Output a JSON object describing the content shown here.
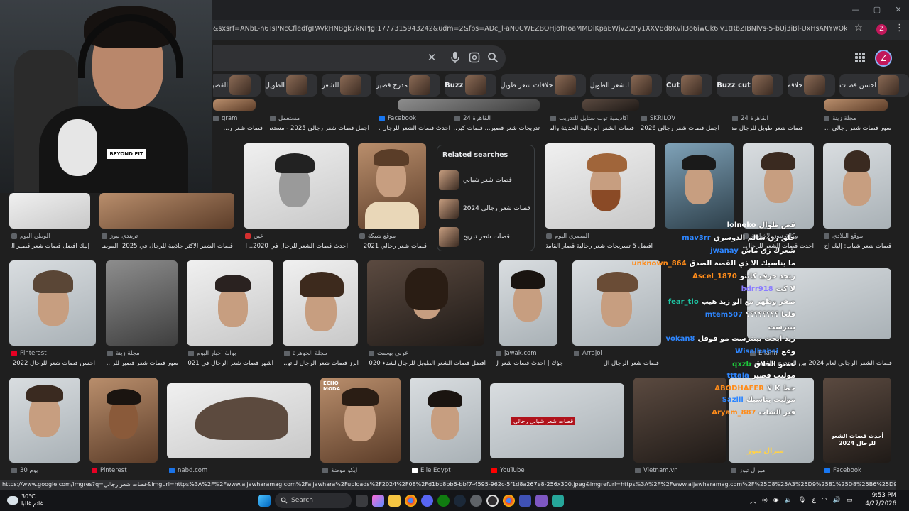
{
  "browser": {
    "url": "&sxsrf=ANbL-n6TsPNcCfledfgPAVkHNBgk7kNPJg:1777315943242&udm=2&fbs=ADc_l-aN0CWEZBOHjofHoaMMDiKpaEWjvZ2Py1XXV8d8KvlI3o6iwGk6lv1tRbZIBNlVs-5-bUj3iBl-UxHsANYwOkWWQqZAJdwuRaSoLHf...",
    "profile_initial": "Z",
    "window_controls": [
      "—",
      "▢",
      "✕"
    ]
  },
  "search": {
    "clear_glyph": "✕",
    "profile_initial": "Z"
  },
  "chips": [
    {
      "label": "احسن قصات"
    },
    {
      "label": "حلاقة"
    },
    {
      "label": "Buzz cut",
      "bold": true
    },
    {
      "label": "Cut",
      "bold": true
    },
    {
      "label": "للشعر الطويل"
    },
    {
      "label": "حلاقات شعر طويل"
    },
    {
      "label": "Buzz",
      "bold": true
    },
    {
      "label": "مدرج قصير"
    },
    {
      "label": "للشعر"
    },
    {
      "label": "الطويل"
    },
    {
      "label": "القصير"
    }
  ],
  "top_row_partial": [
    {
      "source": "gram",
      "caption": "قصات شعر ر..."
    },
    {
      "source": "مستعمل",
      "caption": "أجمل قصات شعر رجالي 2025 - مستعمل"
    },
    {
      "source": "Facebook",
      "caption": "احدث قصات الشعر للرجال ..."
    },
    {
      "source": "القاهرة 24",
      "caption": "تدريجات شعر قصير... قصات كيز..."
    },
    {
      "source": "أكاديمية توب ستايل للتدريب",
      "caption": "قصات الشعر الرجالية الحديثة والم..."
    },
    {
      "source": "SKRILOV",
      "caption": "أجمل قصات شعر رجالي 2026"
    },
    {
      "source": "القاهرة 24",
      "caption": "قصات شعر طويل للرجال مدرج"
    },
    {
      "source": "مجلة زينة",
      "caption": "سور قصات شعر رجالي ..."
    }
  ],
  "row2": [
    {
      "source": "الوطن اليوم",
      "caption": "إليك أفضل قصات شعر قصير ال..."
    },
    {
      "source": "تريندي نيوز",
      "caption": "قصات الشعر الأكثر جاذبية للرجال في 2025: الموضة ت..."
    },
    {
      "source": "عين",
      "caption": "أحدث قصات الشعر للرجال في 2020.. الب..."
    },
    {
      "source": "موقع شبكة",
      "caption": "قصات شعر رجالي 2021"
    },
    {
      "source": "المصري اليوم",
      "caption": "أفضل 5 تسريحات شعر رجالية قصار القامة لو..."
    },
    {
      "source": "أصل 10",
      "caption": "أفضل 10 تسريحات شعر..."
    },
    {
      "source": "وكالة نيوز الإخبارية",
      "caption": "أحدث قصات الشعر للرجال..."
    },
    {
      "source": "موقع البلادي",
      "caption": "قصات شعر شباب: إليك أح..."
    }
  ],
  "related": {
    "title": "Related searches",
    "items": [
      "قصات شعر شبابي",
      "قصات شعر رجالي 2024",
      "قصات شعر تدريج"
    ]
  },
  "row3": [
    {
      "source": "Pinterest",
      "caption": "احسن قصات شعر للرجال 2022"
    },
    {
      "source": "مجلة زينة",
      "caption": "سور قصات شعر قصير للر..."
    },
    {
      "source": "بوابة أخبار اليوم",
      "caption": "أشهر قصات شعر الرجال في 021..."
    },
    {
      "source": "مجلة الجوهرة",
      "caption": "أبرز قصات شعر الرجال لـ تو..."
    },
    {
      "source": "عربي بوست",
      "caption": "أفضل قصات الشعر الطويل للرجال لشتاء 2020"
    },
    {
      "source": "jawak.com",
      "caption": "جؤك | أحدث قصات شعر ل..."
    },
    {
      "source": "Arrajol",
      "caption": "قصات شعر الرجال ال"
    },
    {
      "source": "Elfann",
      "caption": "قصات الشعر الرجالي لعام 2024 بين المتدرج والقصير، جداً وال..."
    }
  ],
  "row4": [
    {
      "source": "30 يوم"
    },
    {
      "source": "Pinterest"
    },
    {
      "source": "nabd.com"
    },
    {
      "source": "ايكو موضة"
    },
    {
      "source": "Elle Egypt"
    },
    {
      "source": "YouTube"
    },
    {
      "source": "Vietnam.vn"
    },
    {
      "source": "ميرال تيوز"
    },
    {
      "source": "Facebook"
    }
  ],
  "thumb_texts": {
    "echo_moda": "ECHO MODA",
    "youtube_overlay": "قصات شعر شبابي رجالي",
    "miral_news": "ميرال نيوز",
    "ahdath": "أحدث قصات الشعر للرجال 2024"
  },
  "chat": [
    {
      "user": "lolneko",
      "msg": "قص طوال",
      "color": "#ffffff"
    },
    {
      "user": "mav3rr",
      "msg": "حلق زي سالم الدوسري",
      "color": "#2e86ff"
    },
    {
      "user": "jwanay",
      "msg": "شعرك زق ماش",
      "color": "#2e86ff"
    },
    {
      "user": "unknown_864",
      "msg": "ما يناسبك الا ذي القصة الصدق",
      "color": "#ff8c1a"
    },
    {
      "user": "Ascel_1870",
      "msg": "رنجد حرف كابتو",
      "color": "#ff8c1a"
    },
    {
      "user": "bdrr918",
      "msg": "لا كت",
      "color": "#8a7cff"
    },
    {
      "user": "fear_tio",
      "msg": "صفر وظهر مع الو زيد هيب",
      "color": "#1ec7a5"
    },
    {
      "user": "mtem507",
      "msg": "قلعا ؟؟؟؟؟؟؟؟",
      "color": "#2e86ff"
    },
    {
      "user": "",
      "msg": "بنترست",
      "color": "#ffffff"
    },
    {
      "user": "vokan8",
      "msg": "زيد ابحث بينترست مو قوقل",
      "color": "#2e86ff"
    },
    {
      "user": "Wisalhabsi",
      "msg": "وعع",
      "color": "#2e86ff"
    },
    {
      "user": "qxzb",
      "msg": "عمتو الحلاق",
      "color": "#1ec73c"
    },
    {
      "user": "tttala",
      "msg": "موليت قصير",
      "color": "#2e86ff"
    },
    {
      "user": "ABODHAFER",
      "msg": "حط K لا",
      "color": "#ff8c1a"
    },
    {
      "user": "Sazlll",
      "msg": "موليت يناسبك",
      "color": "#2e86ff"
    },
    {
      "user": "Aryam_887",
      "msg": "قير الشات",
      "color": "#ff8c1a"
    }
  ],
  "status_url": "https://www.google.com/imgres?q=قصات شعر رجالي&imgurl=https%3A%2F%2Fwww.aljawharamag.com%2Faljawhara%2Fuploads%2F2024%2F08%2Fd1bb8bb6-bbf7-4595-962c-5f1d8a267e8-256x300.jpeg&imgrefurl=https%3A%2F%2Fwww.aljawharamag.com%2F%25D8%25A3%25D9%2581%25D8%25B6%25D9%2584-%25D9%2582%25D8%25B5%",
  "taskbar": {
    "weather_temp": "30°C",
    "weather_desc": "غائم غالبا",
    "search_label": "Search",
    "time": "9:53 PM",
    "date": "4/27/2026",
    "tray_lang": "ع"
  },
  "webcam": {
    "shirt_logo": "BEYOND FIT"
  }
}
